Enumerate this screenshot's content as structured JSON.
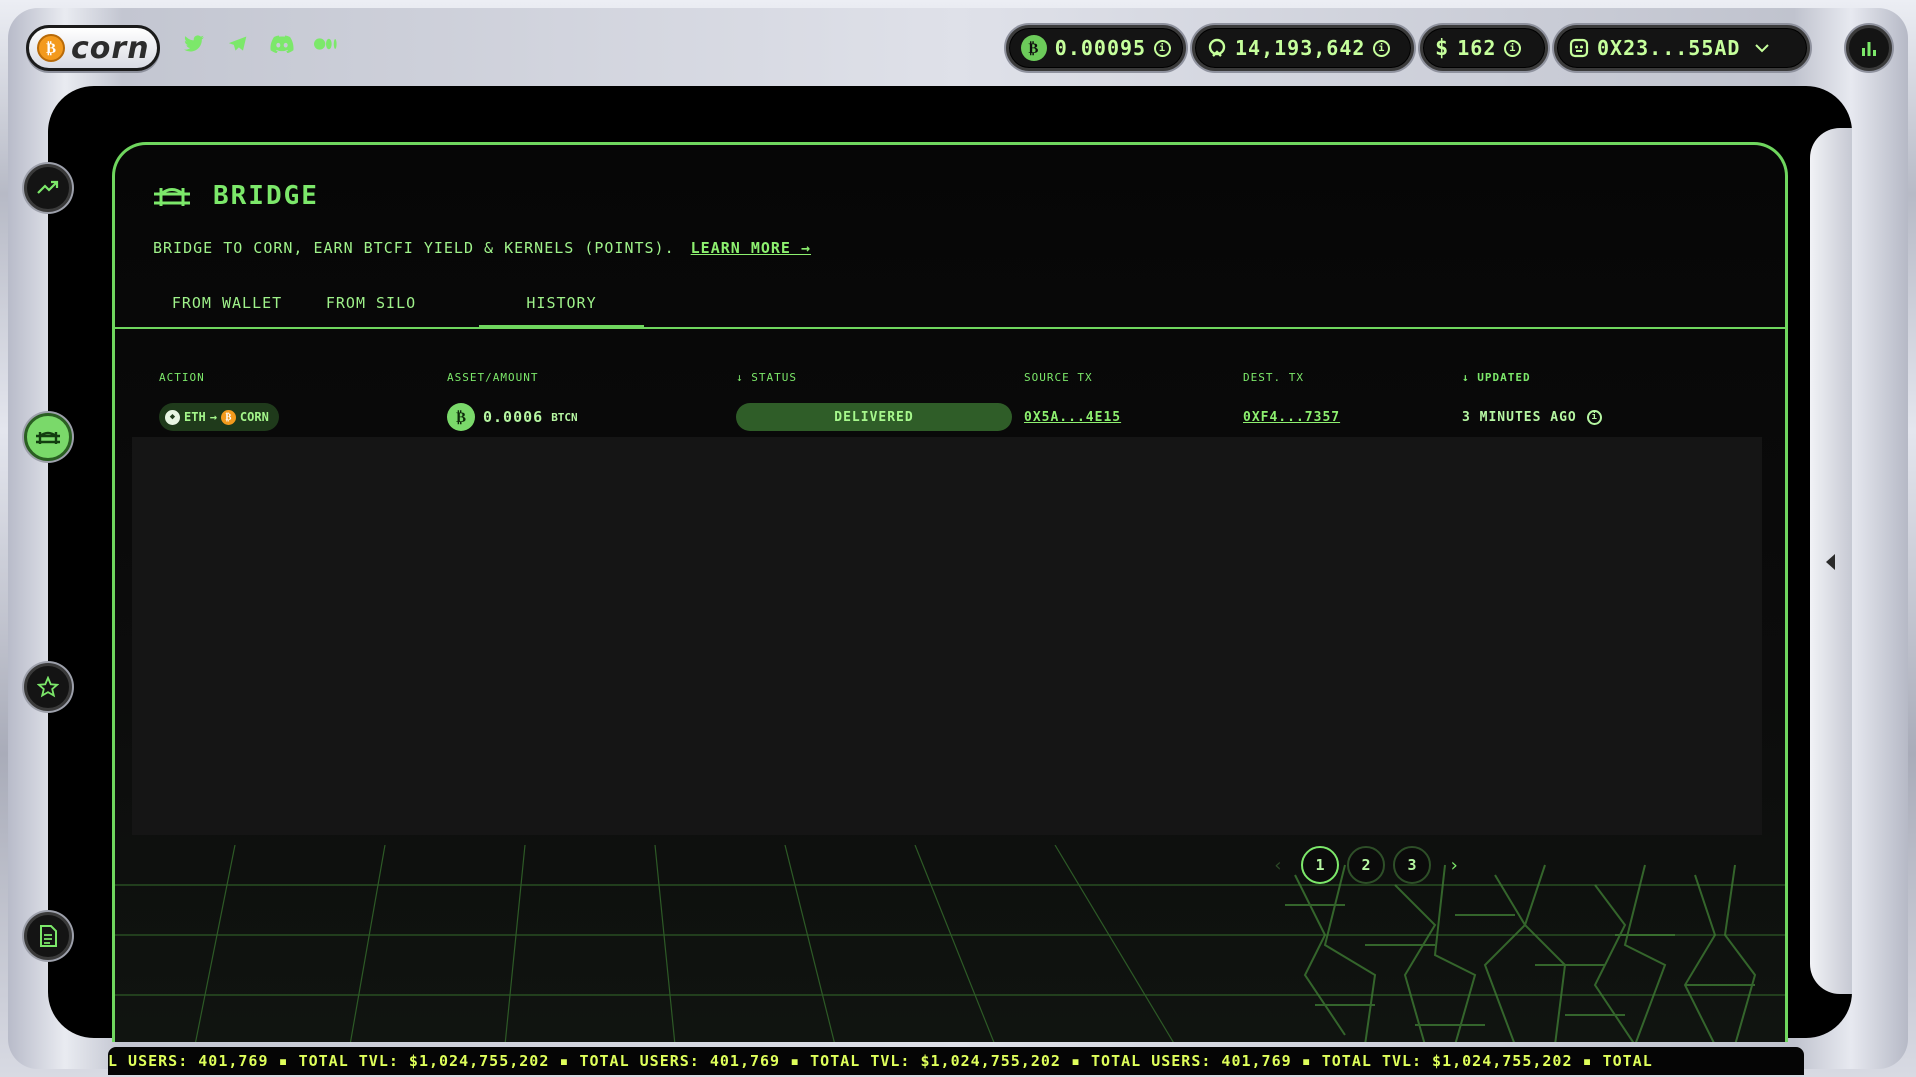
{
  "brand": {
    "name": "corn",
    "logo_letter": "₿"
  },
  "topbar": {
    "btc_balance": "0.00095",
    "kernels": "14,193,642",
    "dollars": "162",
    "wallet": "0X23...55AD"
  },
  "panel": {
    "title": "BRIDGE",
    "subtitle": "BRIDGE TO CORN, EARN BTCFI YIELD & KERNELS (POINTS).",
    "learn_more": "LEARN MORE →",
    "tabs": [
      "FROM WALLET",
      "FROM SILO",
      "HISTORY"
    ],
    "active_tab": "HISTORY"
  },
  "table": {
    "headers": {
      "action": "ACTION",
      "asset": "ASSET/AMOUNT",
      "status": "↓ STATUS",
      "source": "SOURCE TX",
      "dest": "DEST. TX",
      "updated": "↓ UPDATED"
    },
    "row": {
      "from": "ETH",
      "arrow": "→",
      "to": "CORN",
      "amount": "0.0006",
      "asset": "BTCN",
      "status": "DELIVERED",
      "source_tx": "0X5A...4E15",
      "dest_tx": "0XF4...7357",
      "updated": "3 MINUTES AGO"
    }
  },
  "pagination": {
    "pages": [
      "1",
      "2",
      "3"
    ],
    "active": "1"
  },
  "ticker": "L USERS: 401,769 ▪ TOTAL TVL: $1,024,755,202 ▪ TOTAL USERS: 401,769 ▪ TOTAL TVL: $1,024,755,202 ▪ TOTAL USERS: 401,769 ▪ TOTAL TVL: $1,024,755,202 ▪ TOTAL",
  "colors": {
    "accent": "#7ce86a",
    "ticker": "#dfff5a",
    "background": "#000000"
  }
}
